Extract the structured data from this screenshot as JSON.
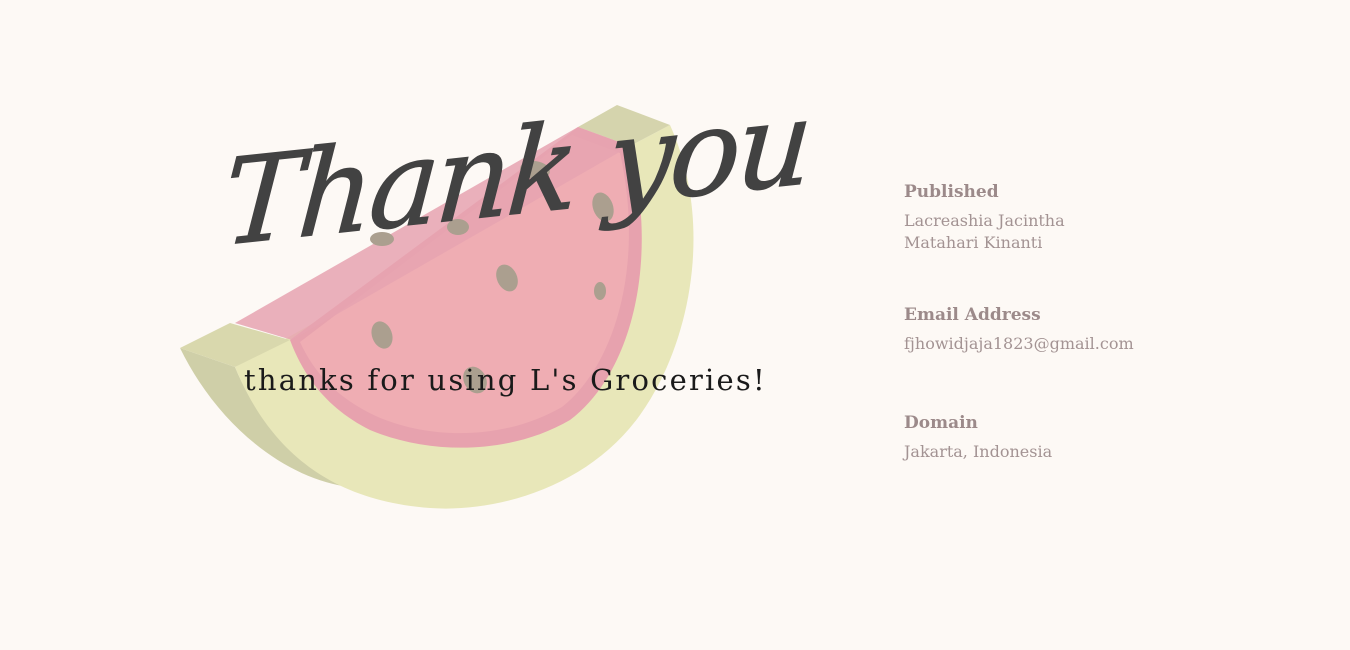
{
  "hero": {
    "title": "Thank you",
    "tagline": "thanks for using L's Groceries!"
  },
  "info": {
    "published": {
      "label": "Published",
      "names": [
        "Lacreashia Jacintha",
        "Matahari Kinanti"
      ]
    },
    "email": {
      "label": "Email Address",
      "value": "fjhowidjaja1823@gmail.com"
    },
    "domain": {
      "label": "Domain",
      "value": "Jakarta, Indonesia"
    }
  },
  "colors": {
    "background": "#fdf9f5",
    "rind": "#e8e7b9",
    "rind_shadow": "#cfcfa8",
    "flesh": "#efadb3",
    "flesh_edge": "#e7a2ae",
    "seed": "#ab9f8f",
    "title": "#424242",
    "label": "#9c8a8a",
    "value": "#a39393"
  }
}
